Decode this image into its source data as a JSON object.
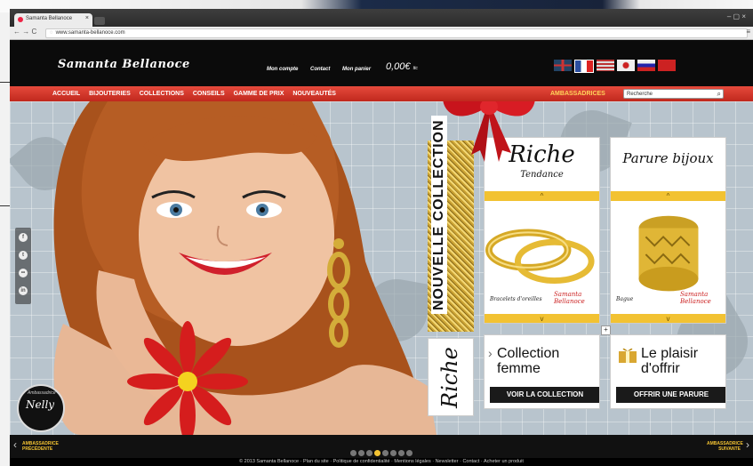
{
  "browser": {
    "tab_title": "Samanta Bellanoce",
    "tab_close": "×",
    "url": "www.samanta-bellanoce.com",
    "nav_buttons": "← → C",
    "window_controls": "– ▢ ×",
    "menu_icon": "≡"
  },
  "site": {
    "logo": "Samanta Bellanoce",
    "account_links": [
      "Mon compte",
      "Contact",
      "Mon panier"
    ],
    "cart_total": "0,00€",
    "cart_suffix": "ttc",
    "flags": [
      "uk-flag",
      "fr-flag",
      "us-flag",
      "jp-flag",
      "ru-flag",
      "cn-flag"
    ],
    "menu": [
      "ACCUEIL",
      "BIJOUTERIES",
      "COLLECTIONS",
      "CONSEILS",
      "GAMME DE PRIX",
      "NOUVEAUTÉS"
    ],
    "ambassadrices": "AMBASSADRICES",
    "search_placeholder": "Recherche"
  },
  "hero": {
    "social": [
      "f",
      "t",
      "••",
      "in"
    ],
    "badge_top": "Ambassadrice",
    "badge_sig": "Nelly",
    "nouvelle_collection": "NOUVELLE COLLECTION",
    "riche_vertical": "Riche",
    "card1": {
      "title": "Riche",
      "subtitle": "Tendance",
      "caption": "Bracelets d'oreilles",
      "sig": "Samanta Bellanoce"
    },
    "card2": {
      "title": "Parure bijoux",
      "caption": "Bague",
      "sig": "Samanta Bellanoce"
    },
    "card3": {
      "title": "Collection femme",
      "button": "VOIR LA COLLECTION"
    },
    "card4": {
      "title": "Le plaisir d'offrir",
      "button": "OFFRIR UNE PARURE"
    },
    "plus_sign": "+",
    "up_chevron": "^",
    "down_chevron": "v"
  },
  "slider": {
    "prev_label": "AMBASSADRICE PRÉCÉDENTE",
    "next_label": "AMBASSADRICE SUIVANTE",
    "dot_count": 8,
    "active_dot": 3,
    "prev_arrow": "‹",
    "next_arrow": "›"
  },
  "footer": "© 2013 Samanta Bellanoce · Plan du site · Politique de confidentialité · Mentions légales · Newsletter · Contact · Acheter un produit",
  "colors": {
    "accent_red": "#d8392b",
    "gold": "#f2c232",
    "header_black": "#0b0b0b"
  }
}
